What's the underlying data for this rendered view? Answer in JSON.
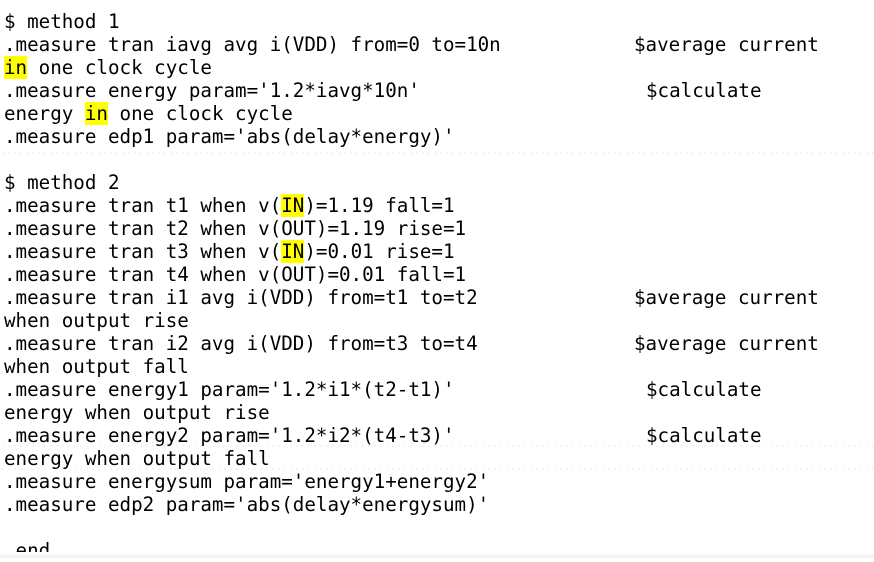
{
  "highlight_color": "#ffff00",
  "lines": {
    "l1": {
      "text": "$ method 1"
    },
    "l2": {
      "text": ".measure tran iavg avg i(VDD) from=0 to=10n",
      "comment": "$average current"
    },
    "l3": {
      "pre": "",
      "hl": "in",
      "post": " one clock cycle"
    },
    "l4": {
      "text": ".measure energy param='1.2*iavg*10n'",
      "comment": "$calculate"
    },
    "l5": {
      "pre": "energy ",
      "hl": "in",
      "post": " one clock cycle"
    },
    "l6": {
      "text": ".measure edp1 param='abs(delay*energy)'"
    },
    "l8": {
      "text": "$ method 2"
    },
    "l9": {
      "pre": ".measure tran t1 when v(",
      "hl": "IN",
      "post": ")=1.19 fall=1"
    },
    "l10": {
      "text": ".measure tran t2 when v(OUT)=1.19 rise=1"
    },
    "l11": {
      "pre": ".measure tran t3 when v(",
      "hl": "IN",
      "post": ")=0.01 rise=1"
    },
    "l12": {
      "text": ".measure tran t4 when v(OUT)=0.01 fall=1"
    },
    "l13": {
      "text": ".measure tran i1 avg i(VDD) from=t1 to=t2",
      "comment": "$average current"
    },
    "l14": {
      "text": "when output rise"
    },
    "l15": {
      "text": ".measure tran i2 avg i(VDD) from=t3 to=t4",
      "comment": "$average current"
    },
    "l16": {
      "text": "when output fall"
    },
    "l17": {
      "text": ".measure energy1 param='1.2*i1*(t2-t1)'",
      "comment": "$calculate"
    },
    "l18": {
      "text": "energy when output rise"
    },
    "l19": {
      "text": ".measure energy2 param='1.2*i2*(t4-t3)'",
      "comment": "$calculate"
    },
    "l20": {
      "text": "energy when output fall"
    },
    "l21": {
      "text": ".measure energysum param='energy1+energy2'"
    },
    "l22": {
      "text": ".measure edp2 param='abs(delay*energysum)'"
    },
    "l24": {
      "text": ".end"
    }
  }
}
